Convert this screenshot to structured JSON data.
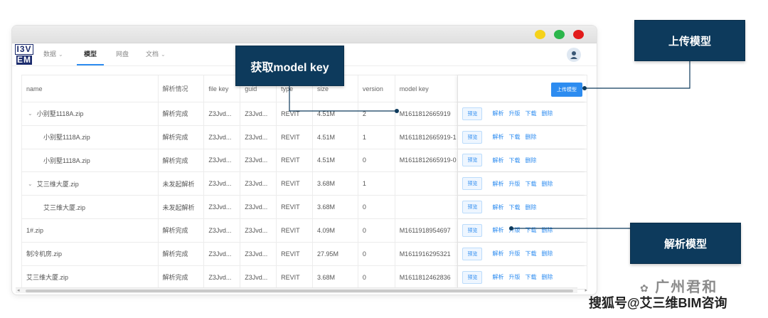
{
  "colors": {
    "accent": "#2d8cf0",
    "callout_bg": "#0d3a5c",
    "dot_yellow": "#f5d21a",
    "dot_green": "#2bb64b",
    "dot_red": "#e21b1b"
  },
  "logo": {
    "line1": "I3V",
    "line2": "EM"
  },
  "nav": {
    "tabs": [
      {
        "label": "数据",
        "has_chevron": true
      },
      {
        "label": "模型",
        "active": true
      },
      {
        "label": "网盘"
      },
      {
        "label": "文档",
        "has_chevron": true
      }
    ],
    "chevron": "⌄",
    "avatar_icon": "user-avatar-icon"
  },
  "table": {
    "headers": {
      "name": "name",
      "status": "解析情况",
      "file_key": "file key",
      "guid": "guid",
      "type": "type",
      "size": "size",
      "version": "version",
      "model_key": "model key"
    },
    "upload_button": "上传模型",
    "row_actions": {
      "preview": "预览",
      "parse": "解析",
      "upgrade": "升版",
      "download": "下载",
      "delete": "删除"
    },
    "rows": [
      {
        "name": "小别墅1118A.zip",
        "status": "解析完成",
        "file_key": "Z3Jvd...",
        "guid": "Z3Jvd...",
        "type": "REVIT",
        "size": "4.51M",
        "version": "2",
        "model_key": "M1611812665919"
      },
      {
        "name": "小别墅1118A.zip",
        "status": "解析完成",
        "file_key": "Z3Jvd...",
        "guid": "Z3Jvd...",
        "type": "REVIT",
        "size": "4.51M",
        "version": "1",
        "model_key": "M1611812665919-1"
      },
      {
        "name": "小别墅1118A.zip",
        "status": "解析完成",
        "file_key": "Z3Jvd...",
        "guid": "Z3Jvd...",
        "type": "REVIT",
        "size": "4.51M",
        "version": "0",
        "model_key": "M1611812665919-0"
      },
      {
        "name": "艾三维大厦.zip",
        "status": "未发起解析",
        "file_key": "Z3Jvd...",
        "guid": "Z3Jvd...",
        "type": "REVIT",
        "size": "3.68M",
        "version": "1",
        "model_key": ""
      },
      {
        "name": "艾三维大厦.zip",
        "status": "未发起解析",
        "file_key": "Z3Jvd...",
        "guid": "Z3Jvd...",
        "type": "REVIT",
        "size": "3.68M",
        "version": "0",
        "model_key": ""
      },
      {
        "name": "1#.zip",
        "status": "解析完成",
        "file_key": "Z3Jvd...",
        "guid": "Z3Jvd...",
        "type": "REVIT",
        "size": "4.09M",
        "version": "0",
        "model_key": "M1611918954697"
      },
      {
        "name": "制冷机房.zip",
        "status": "解析完成",
        "file_key": "Z3Jvd...",
        "guid": "Z3Jvd...",
        "type": "REVIT",
        "size": "27.95M",
        "version": "0",
        "model_key": "M1611916295321"
      },
      {
        "name": "艾三维大厦.zip",
        "status": "解析完成",
        "file_key": "Z3Jvd...",
        "guid": "Z3Jvd...",
        "type": "REVIT",
        "size": "3.68M",
        "version": "0",
        "model_key": "M1611812462836"
      }
    ],
    "expander": "⌄"
  },
  "scroll": {
    "left": "◂",
    "right": "▸"
  },
  "callouts": {
    "get_model_key": "获取model key",
    "upload_model": "上传模型",
    "parse_model": "解析模型"
  },
  "watermark": {
    "brand": "广州君和",
    "source": "搜狐号@艾三维BIM咨询"
  }
}
